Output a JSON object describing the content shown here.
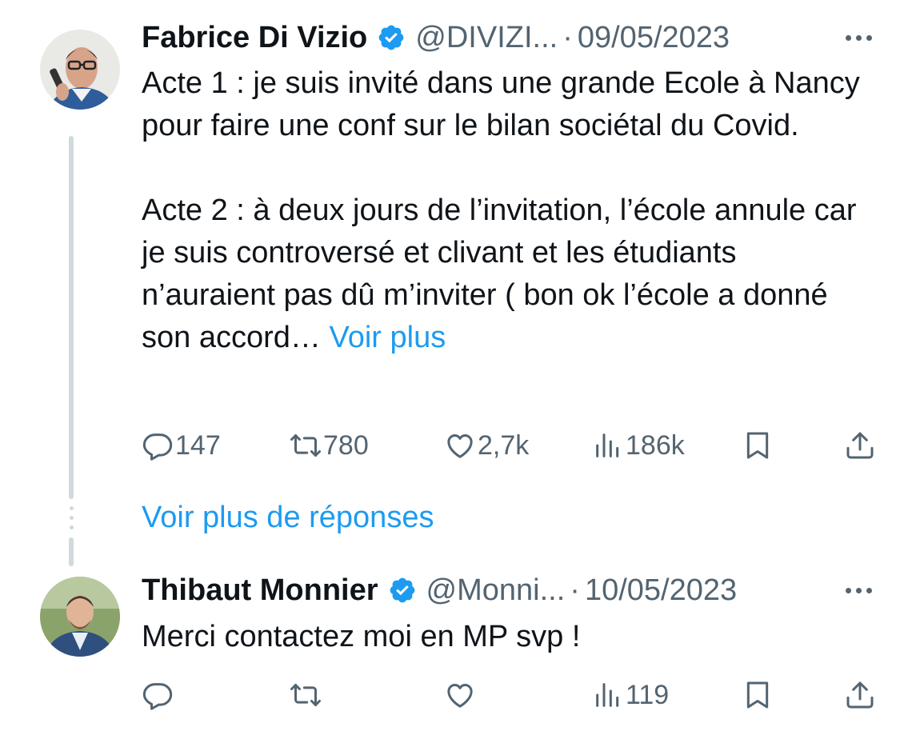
{
  "tweets": [
    {
      "name": "Fabrice Di Vizio",
      "handle": "@DIVIZI...",
      "separator": "·",
      "date": "09/05/2023",
      "text_paragraph_1": "Acte 1 : je suis invité dans une grande Ecole à Nancy pour faire une conf sur le bilan sociétal du Covid.",
      "text_paragraph_2": "Acte 2 : à deux jours de l’invitation, l’école annule car je suis controversé et clivant et les étudiants n’auraient pas dû m’inviter ( bon ok l’école a donné son accord…",
      "show_more": "Voir plus",
      "replies": "147",
      "retweets": "780",
      "likes": "2,7k",
      "views": "186k"
    },
    {
      "name": "Thibaut Monnier",
      "handle": "@Monni...",
      "separator": "·",
      "date": "10/05/2023",
      "text": "Merci contactez moi en MP svp !",
      "views": "119"
    }
  ],
  "more_replies_label": "Voir plus de réponses",
  "colors": {
    "accent": "#1d9bf0",
    "secondary_text": "#536471",
    "primary_text": "#0f1419",
    "thread_line": "#cfd9de"
  },
  "icons": [
    "verified-badge-icon",
    "more-options-icon",
    "reply-icon",
    "retweet-icon",
    "like-icon",
    "views-icon",
    "bookmark-icon",
    "share-icon"
  ]
}
